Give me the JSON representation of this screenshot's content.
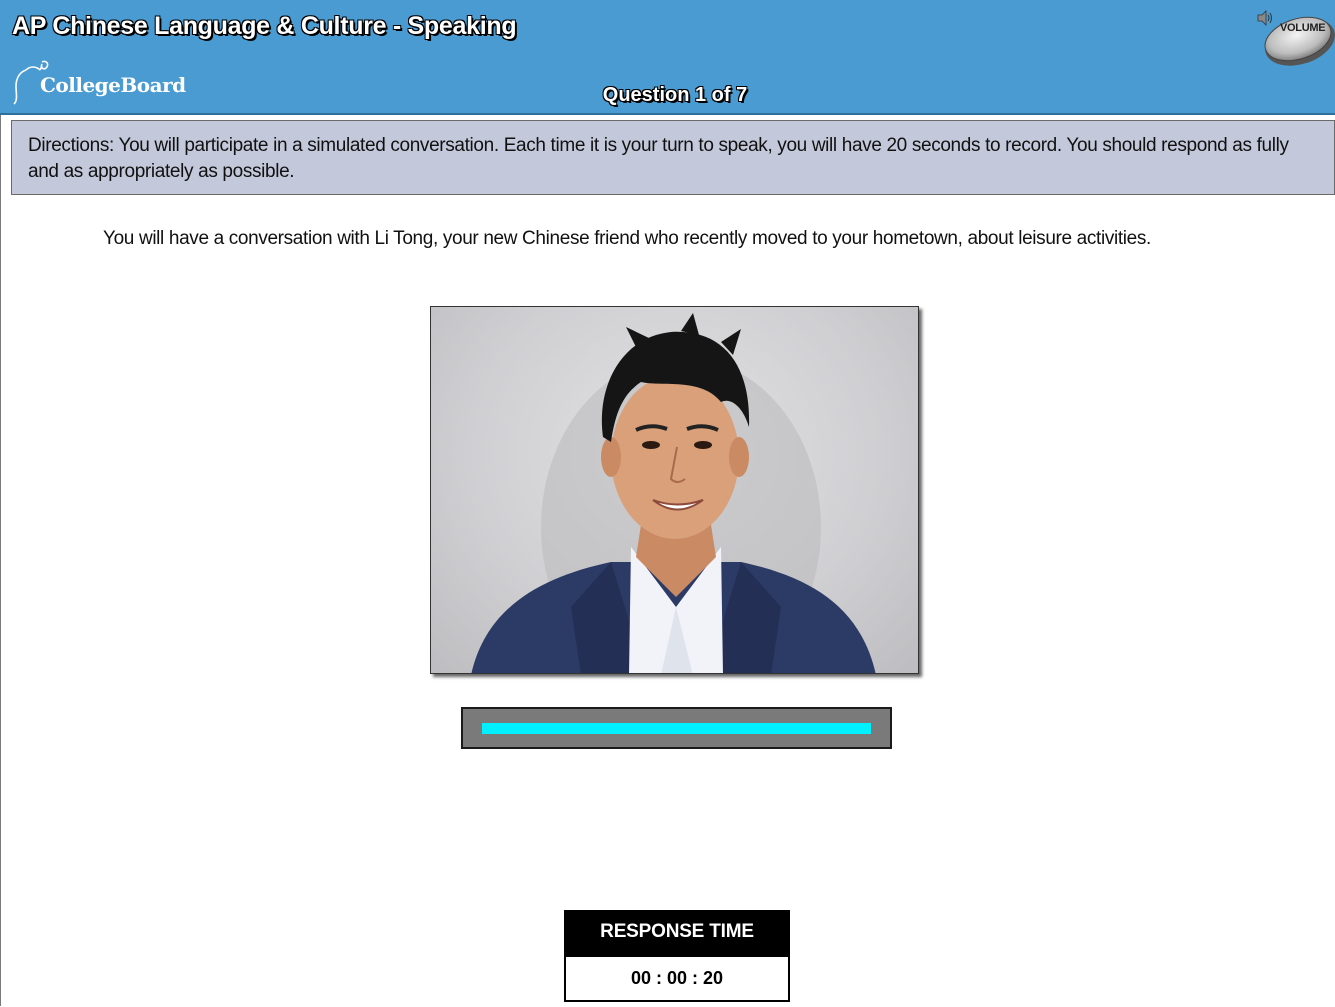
{
  "header": {
    "title": "AP Chinese Language & Culture  -  Speaking",
    "logo_text": "CollegeBoard",
    "question_counter": "Question 1 of 7",
    "volume_label": "VOLUME"
  },
  "directions": {
    "text": "Directions: You will participate in a simulated conversation. Each time it is your turn to speak, you will have 20 seconds to record. You should respond as fully and as appropriately as possible."
  },
  "prompt": {
    "text": "You will have a conversation with Li Tong, your new Chinese friend who recently moved to your hometown, about leisure activities."
  },
  "progress": {
    "fraction": 1.0,
    "color": "#00f0ff"
  },
  "response_time": {
    "label": "RESPONSE TIME",
    "value": "00 : 00 : 20"
  },
  "colors": {
    "header_bg": "#4a9bd2",
    "directions_bg": "#c3c9da"
  },
  "icons": [
    "collegeboard-acorn-icon",
    "speaker-icon"
  ]
}
